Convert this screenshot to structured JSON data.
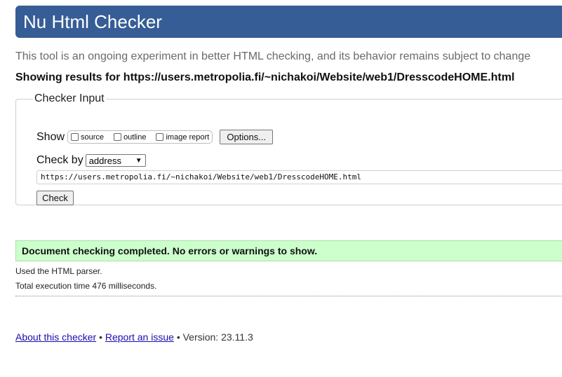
{
  "header": {
    "title": "Nu Html Checker"
  },
  "tagline": "This tool is an ongoing experiment in better HTML checking, and its behavior remains subject to change",
  "showing": "Showing results for https://users.metropolia.fi/~nichakoi/Website/web1/DresscodeHOME.html",
  "checker_input": {
    "legend": "Checker Input",
    "show_label": "Show",
    "options": [
      {
        "label": "source",
        "checked": false
      },
      {
        "label": "outline",
        "checked": false
      },
      {
        "label": "image report",
        "checked": false
      }
    ],
    "options_button": "Options...",
    "check_by_label": "Check by",
    "check_by_value": "address",
    "url_value": "https://users.metropolia.fi/~nichakoi/Website/web1/DresscodeHOME.html",
    "check_button": "Check"
  },
  "result": {
    "message": "Document checking completed. No errors or warnings to show.",
    "parser_note": "Used the HTML parser.",
    "execution_note": "Total execution time 476 milliseconds."
  },
  "footer": {
    "about_link": "About this checker",
    "separator": "•",
    "report_link": "Report an issue",
    "version": "Version: 23.11.3"
  },
  "colors": {
    "header_bg": "#365d95",
    "success_bg": "#ccffcc",
    "link": "#1a0dab"
  }
}
